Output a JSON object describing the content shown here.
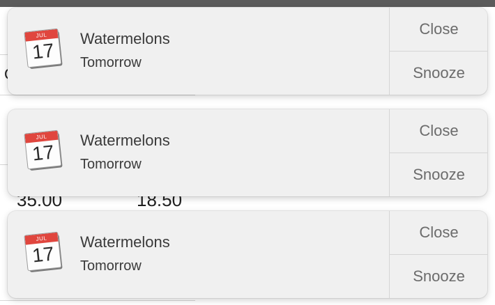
{
  "background": {
    "label_fragment": "C",
    "values": [
      "35.00",
      "18.50"
    ]
  },
  "calendar_icon": {
    "month": "JUL",
    "day": "17"
  },
  "notifications": [
    {
      "title": "Watermelons",
      "subtitle": "Tomorrow",
      "close_label": "Close",
      "snooze_label": "Snooze"
    },
    {
      "title": "Watermelons",
      "subtitle": "Tomorrow",
      "close_label": "Close",
      "snooze_label": "Snooze"
    },
    {
      "title": "Watermelons",
      "subtitle": "Tomorrow",
      "close_label": "Close",
      "snooze_label": "Snooze"
    }
  ],
  "colors": {
    "card_background": "#f0f0f0",
    "calendar_red": "#e0463e",
    "top_bar": "#5b5b5b"
  }
}
